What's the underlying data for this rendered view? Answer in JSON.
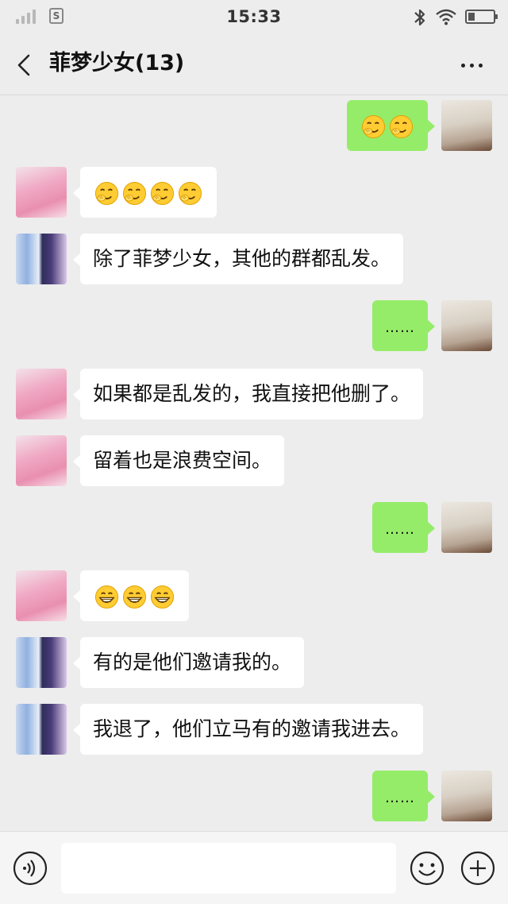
{
  "status_bar": {
    "time": "15:33",
    "sim_label": "S",
    "battery_level": 0.25
  },
  "header": {
    "title": "菲梦少女(13)",
    "back_icon": "chevron-left-icon",
    "more_icon": "more-dots-icon"
  },
  "messages": [
    {
      "side": "out",
      "avatar": "user-c",
      "text": "",
      "emoji": [
        "hehe",
        "hehe"
      ]
    },
    {
      "side": "in",
      "avatar": "user-a",
      "text": "",
      "emoji": [
        "hehe",
        "hehe",
        "hehe",
        "hehe"
      ]
    },
    {
      "side": "in",
      "avatar": "user-b",
      "text": "除了菲梦少女，其他的群都乱发。"
    },
    {
      "side": "out",
      "avatar": "user-c",
      "text": "……"
    },
    {
      "side": "in",
      "avatar": "user-a",
      "text": "如果都是乱发的，我直接把他删了。"
    },
    {
      "side": "in",
      "avatar": "user-a",
      "text": "留着也是浪费空间。"
    },
    {
      "side": "out",
      "avatar": "user-c",
      "text": "……"
    },
    {
      "side": "in",
      "avatar": "user-a",
      "text": "",
      "emoji": [
        "grin",
        "grin",
        "grin"
      ]
    },
    {
      "side": "in",
      "avatar": "user-b",
      "text": "有的是他们邀请我的。"
    },
    {
      "side": "in",
      "avatar": "user-b",
      "text": "我退了，他们立马有的邀请我进去。"
    },
    {
      "side": "out",
      "avatar": "user-c",
      "text": "……"
    }
  ],
  "input_bar": {
    "text_value": "",
    "voice_icon": "voice-icon",
    "emoji_icon": "smiley-icon",
    "plus_icon": "plus-circle-icon"
  },
  "colors": {
    "chat_background": "#ededed",
    "outgoing_bubble": "#95ec69",
    "incoming_bubble": "#ffffff"
  }
}
